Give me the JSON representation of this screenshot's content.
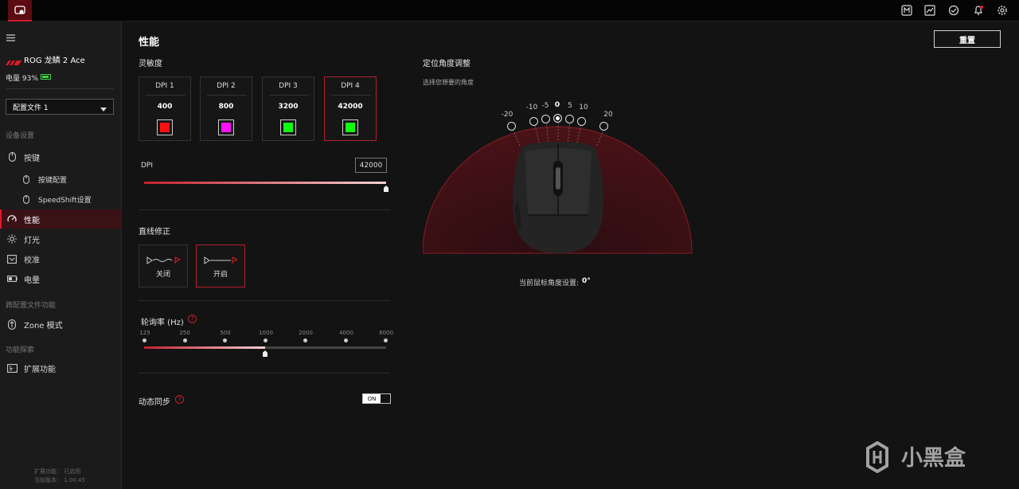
{
  "topbar": {
    "icons": [
      "app-mouse-icon",
      "grid-icon",
      "image-icon",
      "sync-icon",
      "bell-icon",
      "gear-icon"
    ]
  },
  "sidebar": {
    "device_name": "ROG 龙鳞 2 Ace",
    "battery_text": "电量 93%",
    "battery_level": 0.93,
    "profile_select": "配置文件 1",
    "section_device": "设备设置",
    "items": {
      "buttons": "按键",
      "button_config": "按键配置",
      "speedshift": "SpeedShift设置",
      "performance": "性能",
      "lighting": "灯光",
      "calibration": "校准",
      "power": "电量"
    },
    "section_cross": "跨配置文件功能",
    "zone_mode": "Zone 模式",
    "section_explore": "功能探索",
    "extensions": "扩展功能",
    "footer_line1": "扩展功能：  已启用",
    "footer_line2": "当前版本：  1.00.45"
  },
  "main": {
    "title": "性能",
    "reset_label": "重置",
    "sensitivity_label": "灵敏度",
    "dpi_cards": [
      {
        "name": "DPI 1",
        "value": "400",
        "color": "#ff1010"
      },
      {
        "name": "DPI 2",
        "value": "800",
        "color": "#ff10ff"
      },
      {
        "name": "DPI 3",
        "value": "3200",
        "color": "#10ff10"
      },
      {
        "name": "DPI 4",
        "value": "42000",
        "color": "#10ff10"
      }
    ],
    "selected_dpi_index": 3,
    "dpi_label": "DPI",
    "dpi_value": "42000",
    "dpi_slider_fraction": 1.0,
    "angle_snapping_label": "直线修正",
    "angle_snapping_off": "关闭",
    "angle_snapping_on": "开启",
    "polling_label": "轮询率 (Hz)",
    "polling_ticks": [
      "125",
      "250",
      "500",
      "1000",
      "2000",
      "4000",
      "8000"
    ],
    "polling_selected_index": 3,
    "motion_sync_label": "动态同步",
    "motion_sync_toggle": "ON"
  },
  "angle_tuning": {
    "title": "定位角度调整",
    "subtitle": "选择您想要的角度",
    "ticks": [
      "-20",
      "-10",
      "-5",
      "0",
      "5",
      "10",
      "20"
    ],
    "selected": "0",
    "current_prefix": "当前鼠标角度设置:",
    "current_value": "0°"
  }
}
